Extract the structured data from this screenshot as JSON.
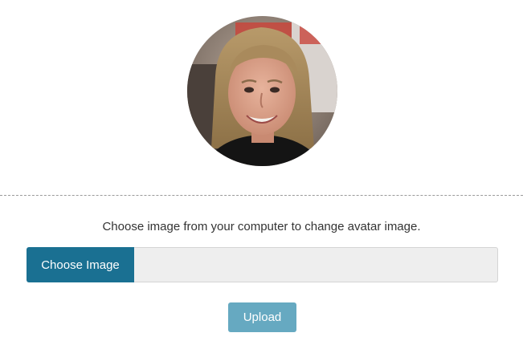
{
  "avatar": {
    "alt": "avatar image"
  },
  "instruction_text": "Choose image from your computer to change avatar image.",
  "file_input": {
    "button_label": "Choose Image",
    "value": ""
  },
  "upload_button": {
    "label": "Upload",
    "color": "#66a9c1"
  },
  "colors": {
    "choose_button": "#1a7092",
    "divider": "#9a9a9a",
    "file_field_bg": "#eeeeee"
  }
}
